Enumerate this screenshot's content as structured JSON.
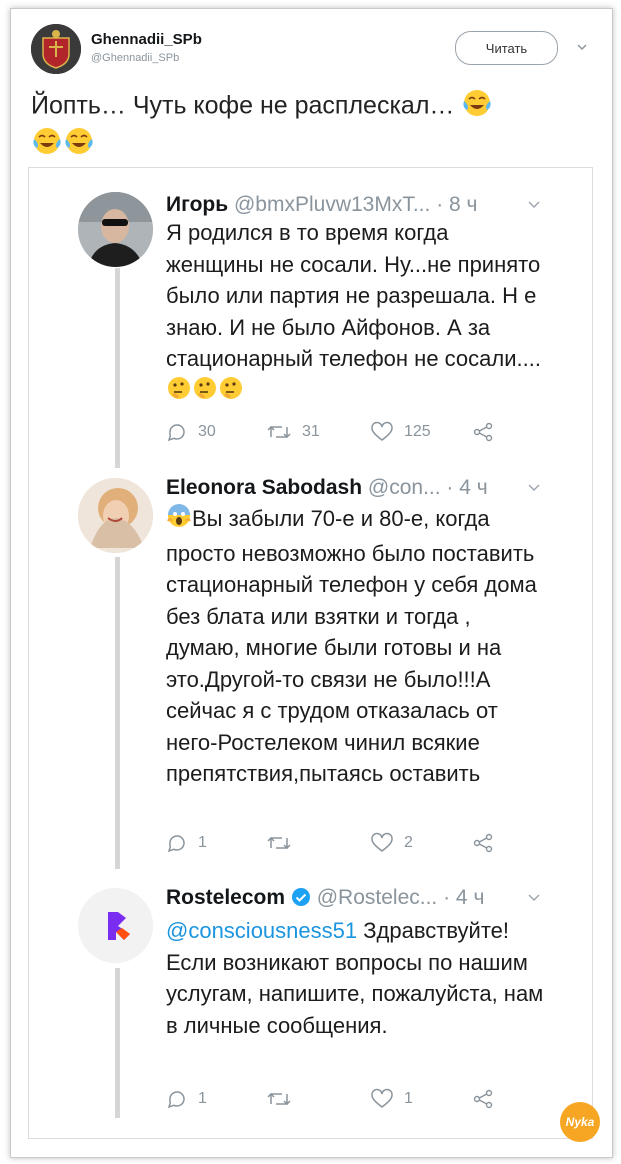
{
  "author": {
    "name": "Ghennadii_SPb",
    "handle": "@Ghennadii_SPb",
    "follow_label": "Читать"
  },
  "tweet": {
    "text": "Йопть… Чуть кофе не расплескал…",
    "emoji": [
      "😂",
      "😂",
      "😂"
    ]
  },
  "replies": [
    {
      "name": "Игорь",
      "handle": "@bmxPluvw13MxT...",
      "time": "· 8 ч",
      "text": "Я родился в то время когда женщины не сосали. Ну...не принято было или партия не разрешала. Н е знаю. И не было Айфонов. А за стационарный телефон не сосали....",
      "emoji": [
        "🤔",
        "🤔",
        "🤔"
      ],
      "replies_count": "30",
      "retweets_count": "31",
      "likes_count": "125"
    },
    {
      "name": "Eleonora Sabodash",
      "handle": "@con...",
      "time": "· 4 ч",
      "emoji_prefix": "😱",
      "text": "Вы забыли 70-е и 80-е, когда просто невозможно было поставить стационарный телефон у себя дома без блата или взятки и тогда , думаю, многие были готовы и на это.Другой-то связи не было!!!А сейчас я с трудом отказалась от него-Ростелеком чинил всякие препятствия,пытаясь оставить",
      "replies_count": "1",
      "retweets_count": "",
      "likes_count": "2"
    },
    {
      "name": "Rostelecom",
      "handle": "@Rostelec...",
      "time": "· 4 ч",
      "mention": "@consciousness51",
      "text": "Здравствуйте! Если возникают вопросы по нашим услугам, напишите, пожалуйста, нам в личные сообщения.",
      "replies_count": "1",
      "retweets_count": "",
      "likes_count": "1"
    }
  ],
  "watermark": "Nyka",
  "colors": {
    "link": "#1b95e0",
    "muted": "#8a949c",
    "verified": "#1da1f2",
    "rostelecom_accent": "#7a2cf0"
  }
}
